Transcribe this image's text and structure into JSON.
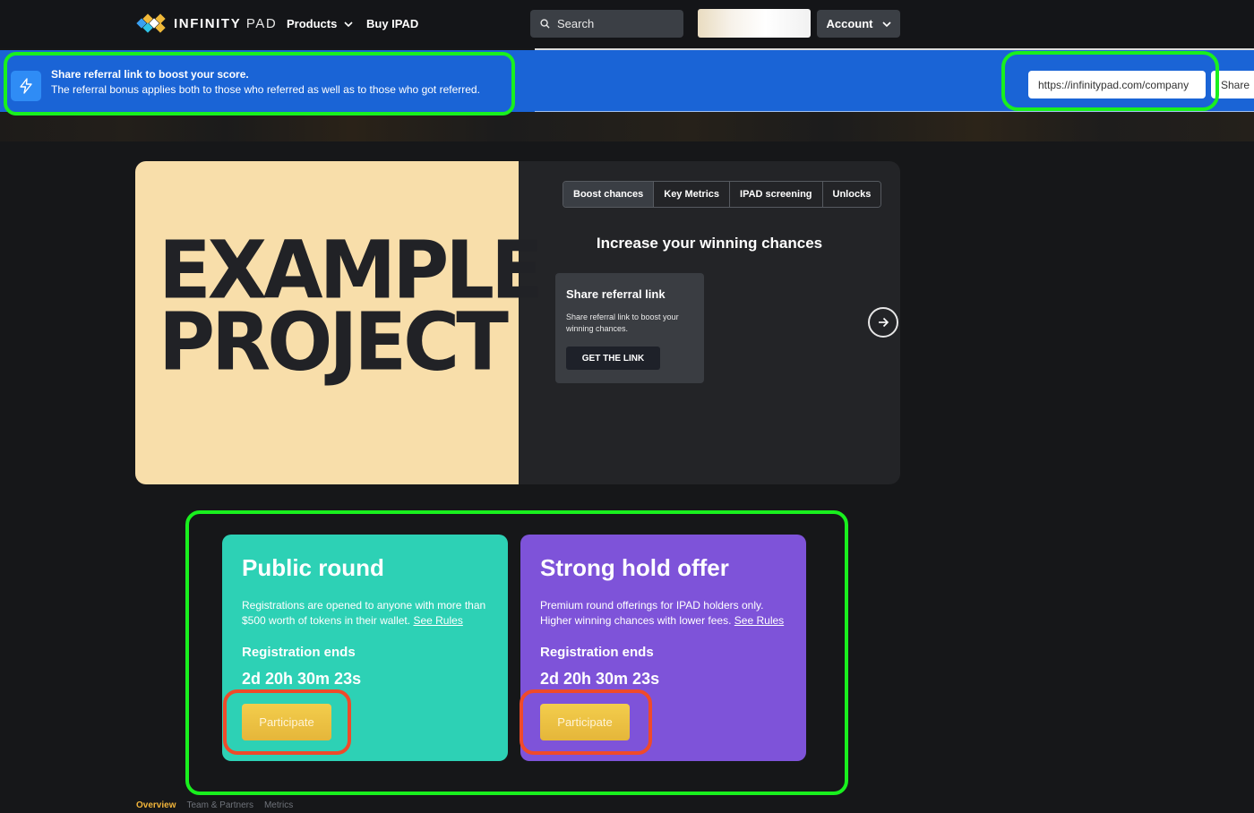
{
  "header": {
    "logo_text": "INFINITY",
    "logo_text_thin": "PAD",
    "nav": [
      {
        "label": "Products",
        "has_dropdown": true
      },
      {
        "label": "Buy IPAD",
        "has_dropdown": false
      }
    ],
    "search_placeholder": "Search",
    "account_label": "Account"
  },
  "banner": {
    "icon": "lightning-icon",
    "title": "Share referral link to boost your score.",
    "description": "The referral bonus applies both to those who referred as well as to those who got referred.",
    "url_value": "https://infinitypad.com/company",
    "share_label": "Share"
  },
  "hero": {
    "project_line1": "EXAMPLE",
    "project_line2": "PROJECT",
    "tabs": [
      "Boost chances",
      "Key Metrics",
      "IPAD screening",
      "Unlocks"
    ],
    "active_tab": "Boost chances",
    "heading": "Increase your winning chances",
    "card": {
      "title": "Share referral link",
      "description": "Share referral link to boost your winning chances.",
      "button_label": "GET THE LINK"
    }
  },
  "rounds": [
    {
      "title": "Public round",
      "description": "Registrations are opened to anyone with more than $500 worth of tokens in their wallet.",
      "rules_link": "See Rules",
      "label": "Registration ends",
      "timer": "2d 20h 30m 23s",
      "button_label": "Participate",
      "color": "#2dd1b5"
    },
    {
      "title": "Strong hold offer",
      "description": "Premium round offerings for IPAD holders only. Higher winning chances with lower fees.",
      "rules_link": "See Rules",
      "label": "Registration ends",
      "timer": "2d 20h 30m 23s",
      "button_label": "Participate",
      "color": "#7e53d9"
    }
  ],
  "bottom_tabs": [
    "Overview",
    "Team & Partners",
    "Metrics"
  ],
  "colors": {
    "banner": "#1a64d6",
    "highlight_green": "#19f01e",
    "highlight_red": "#ef4a2a",
    "participate": "#e8bd40"
  }
}
